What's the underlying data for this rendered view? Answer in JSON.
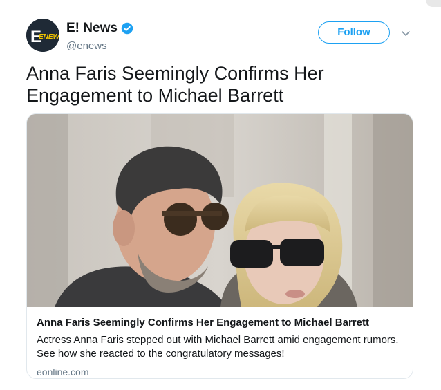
{
  "account": {
    "display_name": "E! News",
    "handle": "@enews",
    "avatar_text": "ENEWS",
    "verified": true
  },
  "actions": {
    "follow_label": "Follow",
    "accent_color": "#1da1f2"
  },
  "icons": {
    "verified": "verified-badge-icon",
    "more": "chevron-down-icon"
  },
  "tweet": {
    "text": "Anna Faris Seemingly Confirms Her Engagement to Michael Barrett"
  },
  "card": {
    "title": "Anna Faris Seemingly Confirms Her Engagement to Michael Barrett",
    "description": "Actress Anna Faris stepped out with Michael Barrett amid engagement rumors. See how she reacted to the congratulatory messages!",
    "domain": "eonline.com"
  }
}
